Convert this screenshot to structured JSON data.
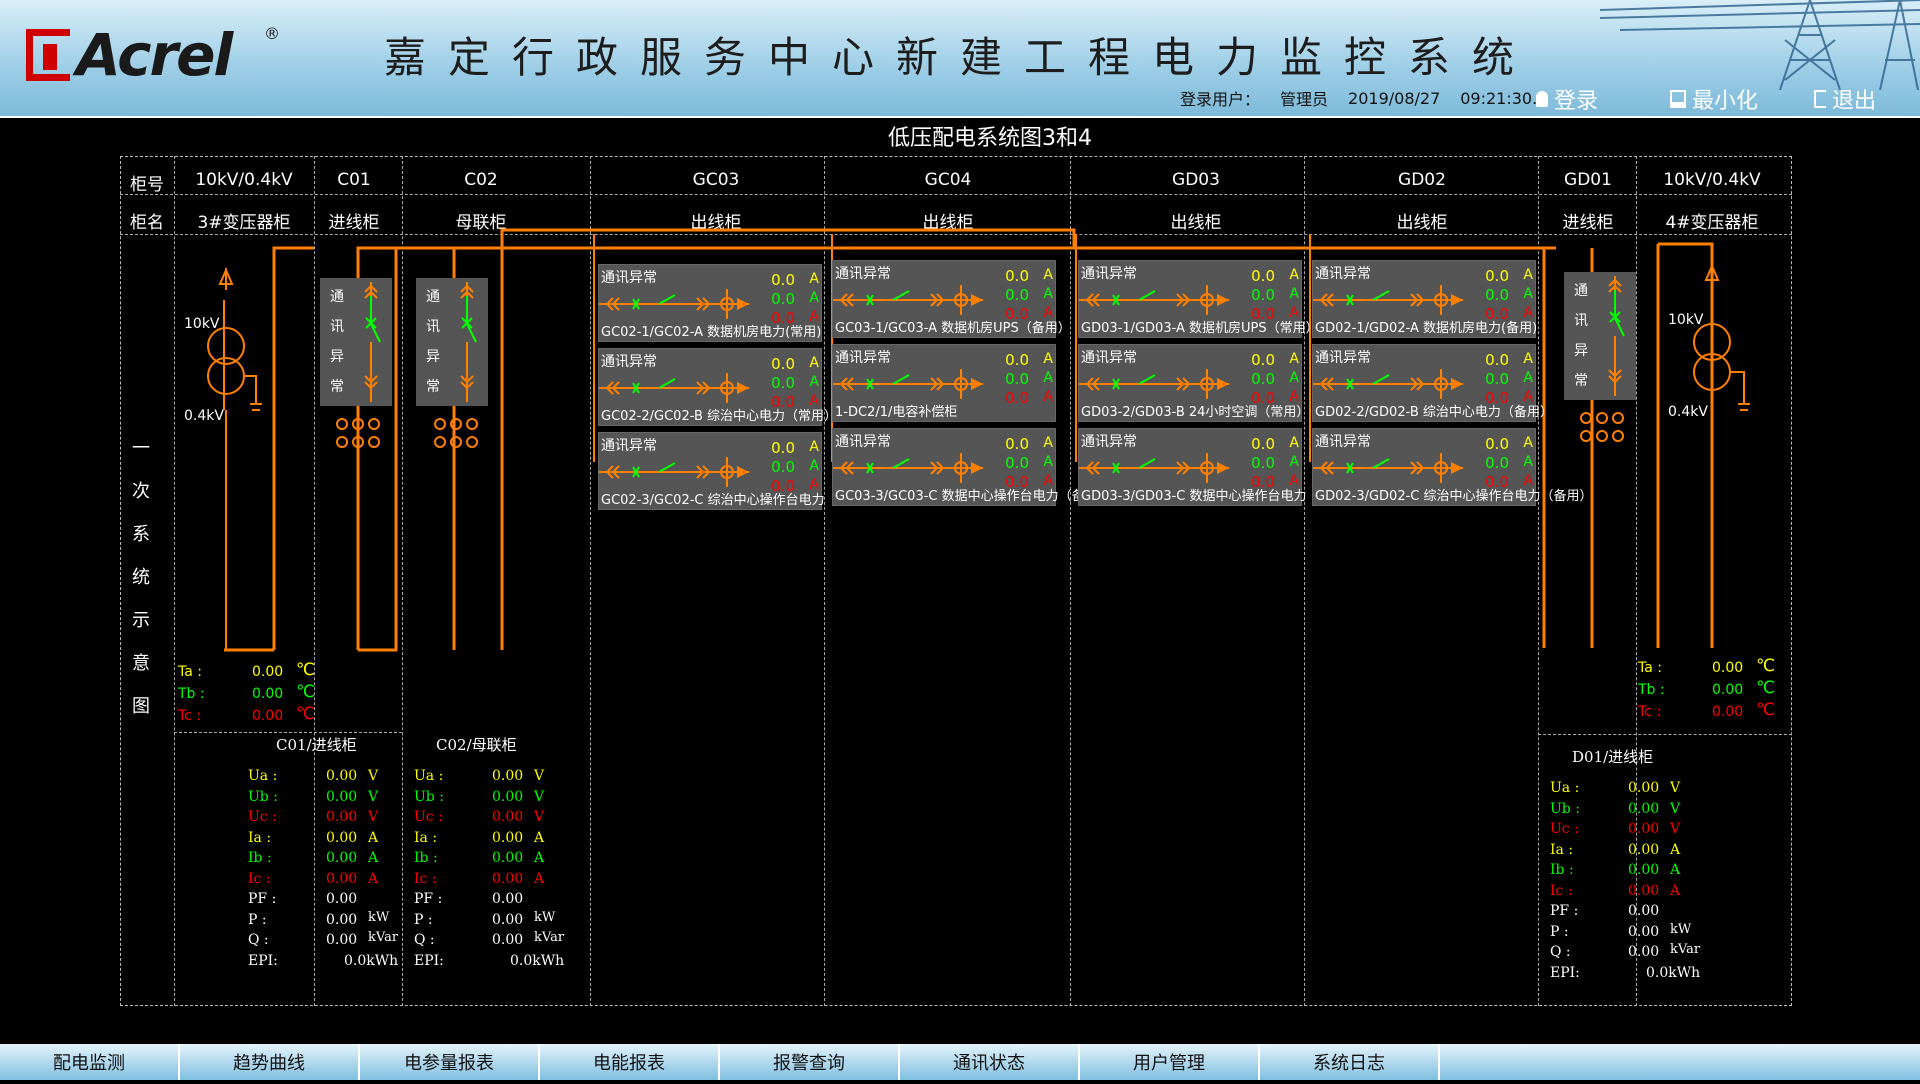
{
  "header": {
    "logo_text": "Acrel",
    "logo_reg": "®",
    "title": "嘉定行政服务中心新建工程电力监控系统",
    "user_label": "登录用户：",
    "user_name": "管理员",
    "date": "2019/08/27",
    "time": "09:21:30.4",
    "login": "登录",
    "minimize": "最小化",
    "exit": "退出"
  },
  "diagram_title": "低压配电系统图3和4",
  "col_header": {
    "row1_label": "柜号",
    "row2_label": "柜名",
    "cols": [
      {
        "no": "10kV/0.4kV",
        "name": "3#变压器柜"
      },
      {
        "no": "C01",
        "name": "进线柜"
      },
      {
        "no": "C02",
        "name": "母联柜"
      },
      {
        "no": "GC03",
        "name": "出线柜"
      },
      {
        "no": "GC04",
        "name": "出线柜"
      },
      {
        "no": "GD03",
        "name": "出线柜"
      },
      {
        "no": "GD02",
        "name": "出线柜"
      },
      {
        "no": "GD01",
        "name": "进线柜"
      },
      {
        "no": "10kV/0.4kV",
        "name": "4#变压器柜"
      }
    ]
  },
  "side_label": [
    "一",
    "次",
    "系",
    "统",
    "示",
    "意",
    "图"
  ],
  "comm_err": "通讯异常",
  "vbox_chars": [
    "通",
    "讯",
    "异",
    "常"
  ],
  "transformer": {
    "hv": "10kV",
    "lv": "0.4kV"
  },
  "feeders": [
    {
      "name": "GC02-1/GC02-A 数据机房电力(常用)",
      "vals": [
        "0.0",
        "0.0",
        "0.0"
      ]
    },
    {
      "name": "GC02-2/GC02-B 综治中心电力（常用）",
      "vals": [
        "0.0",
        "0.0",
        "0.0"
      ]
    },
    {
      "name": "GC02-3/GC02-C 综治中心操作台电力",
      "vals": [
        "0.0",
        "0.0",
        "0.0"
      ]
    },
    {
      "name": "GC03-1/GC03-A 数据机房UPS（备用）",
      "vals": [
        "0.0",
        "0.0",
        "0.0"
      ]
    },
    {
      "name": "1-DC2/1/电容补偿柜",
      "vals": [
        "0.0",
        "0.0",
        "0.0"
      ]
    },
    {
      "name": "GC03-3/GC03-C 数据中心操作台电力（备",
      "vals": [
        "0.0",
        "0.0",
        "0.0"
      ]
    },
    {
      "name": "GD03-1/GD03-A 数据机房UPS（常用）",
      "vals": [
        "0.0",
        "0.0",
        "0.0"
      ]
    },
    {
      "name": "GD03-2/GD03-B 24小时空调（常用）",
      "vals": [
        "0.0",
        "0.0",
        "0.0"
      ]
    },
    {
      "name": "GD03-3/GD03-C 数据中心操作台电力",
      "vals": [
        "0.0",
        "0.0",
        "0.0"
      ]
    },
    {
      "name": "GD02-1/GD02-A 数据机房电力(备用)",
      "vals": [
        "0.0",
        "0.0",
        "0.0"
      ]
    },
    {
      "name": "GD02-2/GD02-B 综治中心电力（备用）",
      "vals": [
        "0.0",
        "0.0",
        "0.0"
      ]
    },
    {
      "name": "GD02-3/GD02-C 综治中心操作台电力（备用）",
      "vals": [
        "0.0",
        "0.0",
        "0.0"
      ]
    }
  ],
  "unit_A": "A",
  "temps_left": [
    {
      "k": "Ta :",
      "v": "0.00",
      "u": "℃"
    },
    {
      "k": "Tb :",
      "v": "0.00",
      "u": "℃"
    },
    {
      "k": "Tc :",
      "v": "0.00",
      "u": "℃"
    }
  ],
  "temps_right": [
    {
      "k": "Ta :",
      "v": "0.00",
      "u": "℃"
    },
    {
      "k": "Tb :",
      "v": "0.00",
      "u": "℃"
    },
    {
      "k": "Tc :",
      "v": "0.00",
      "u": "℃"
    }
  ],
  "meters": [
    {
      "title": "C01/进线柜"
    },
    {
      "title": "C02/母联柜"
    },
    {
      "title": "D01/进线柜"
    }
  ],
  "meas_rows": [
    {
      "k": "Ua :",
      "v": "0.00",
      "u": "V"
    },
    {
      "k": "Ub :",
      "v": "0.00",
      "u": "V"
    },
    {
      "k": "Uc :",
      "v": "0.00",
      "u": "V"
    },
    {
      "k": "Ia :",
      "v": "0.00",
      "u": "A"
    },
    {
      "k": "Ib :",
      "v": "0.00",
      "u": "A"
    },
    {
      "k": "Ic :",
      "v": "0.00",
      "u": "A"
    },
    {
      "k": "PF :",
      "v": "0.00",
      "u": ""
    },
    {
      "k": "P  :",
      "v": "0.00",
      "u": "kW"
    },
    {
      "k": "Q  :",
      "v": "0.00",
      "u": "kVar"
    },
    {
      "k": "EPI:",
      "v": "0.0kWh",
      "u": ""
    }
  ],
  "colors": {
    "accent": "#ff8000",
    "yellow": "#ffff00",
    "green": "#00ff00",
    "red": "#ff0000"
  },
  "nav": [
    "配电监测",
    "趋势曲线",
    "电参量报表",
    "电能报表",
    "报警查询",
    "通讯状态",
    "用户管理",
    "系统日志"
  ]
}
